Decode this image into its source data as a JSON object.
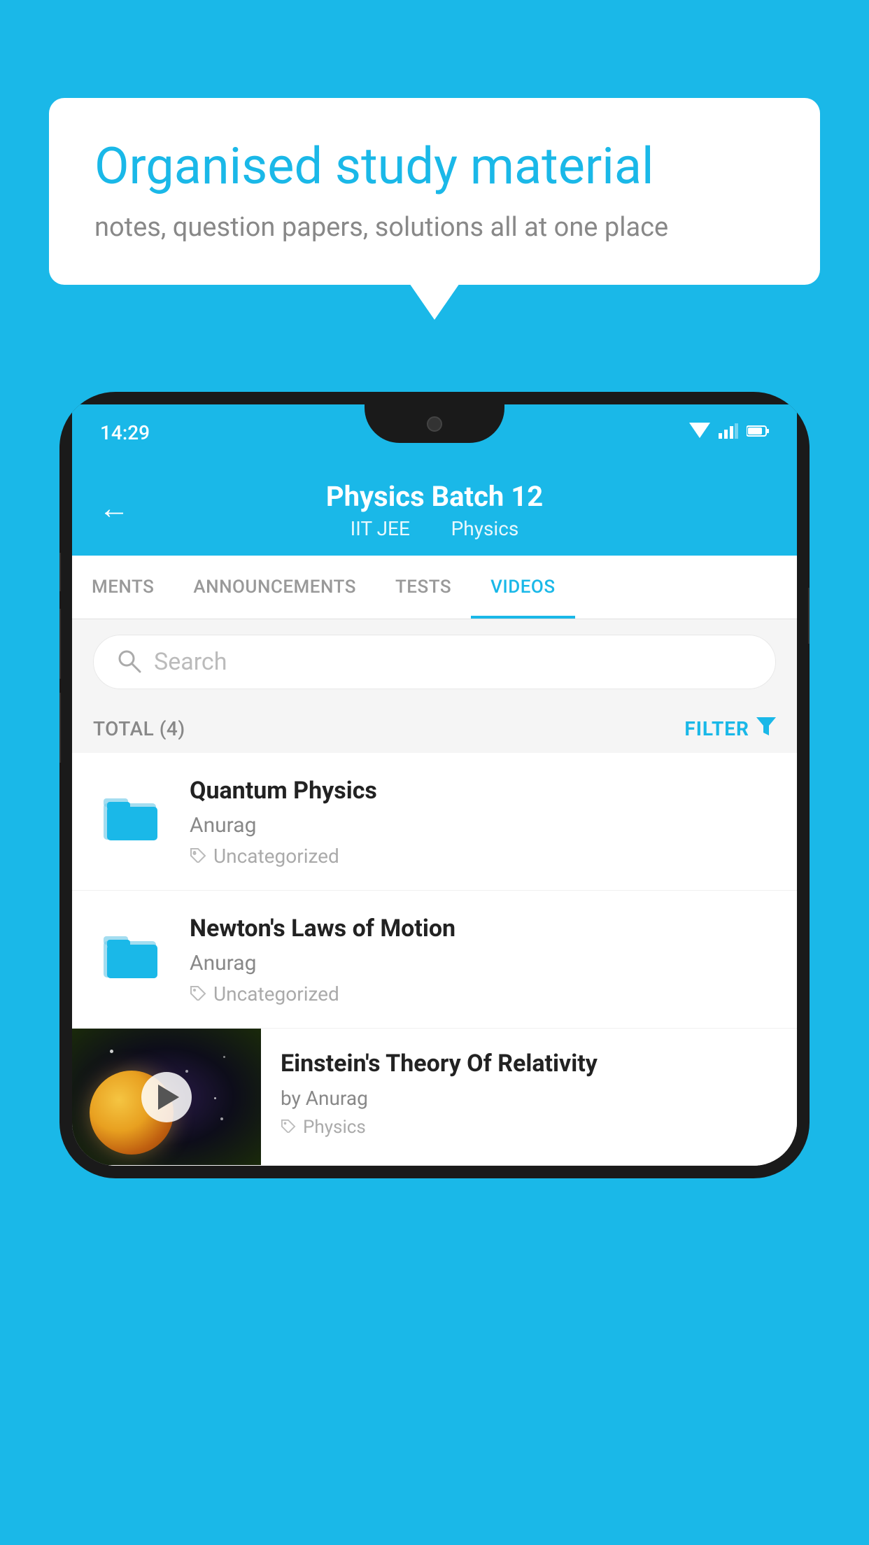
{
  "background": {
    "color": "#1ab8e8"
  },
  "speech_bubble": {
    "title": "Organised study material",
    "subtitle": "notes, question papers, solutions all at one place"
  },
  "phone": {
    "status_bar": {
      "time": "14:29",
      "wifi": "▾",
      "signal": "▴",
      "battery": "▮"
    },
    "header": {
      "back_label": "←",
      "title": "Physics Batch 12",
      "subtitle_1": "IIT JEE",
      "subtitle_2": "Physics"
    },
    "tabs": [
      {
        "label": "MENTS",
        "active": false
      },
      {
        "label": "ANNOUNCEMENTS",
        "active": false
      },
      {
        "label": "TESTS",
        "active": false
      },
      {
        "label": "VIDEOS",
        "active": true
      }
    ],
    "search": {
      "placeholder": "Search"
    },
    "filter": {
      "total_label": "TOTAL (4)",
      "filter_label": "FILTER"
    },
    "videos": [
      {
        "id": 1,
        "title": "Quantum Physics",
        "author": "Anurag",
        "tag": "Uncategorized",
        "has_thumbnail": false
      },
      {
        "id": 2,
        "title": "Newton's Laws of Motion",
        "author": "Anurag",
        "tag": "Uncategorized",
        "has_thumbnail": false
      },
      {
        "id": 3,
        "title": "Einstein's Theory Of Relativity",
        "author": "by Anurag",
        "tag": "Physics",
        "has_thumbnail": true
      }
    ]
  }
}
